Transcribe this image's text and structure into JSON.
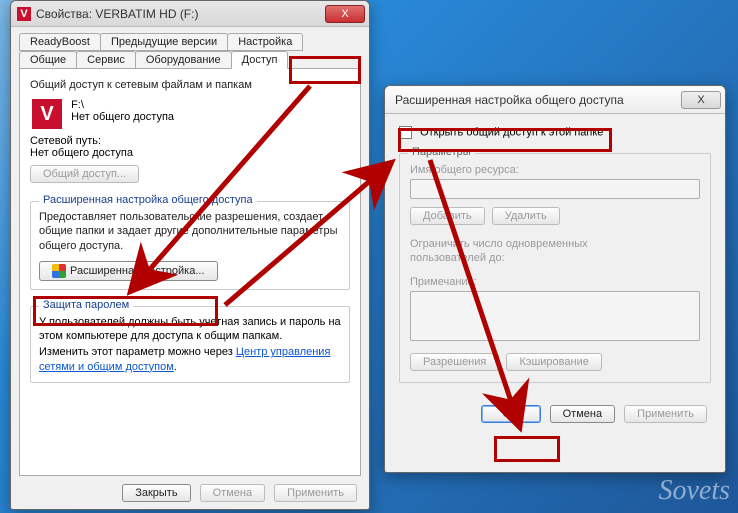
{
  "propWindow": {
    "title": "Свойства: VERBATIM HD (F:)",
    "tabsRow1": [
      "ReadyBoost",
      "Предыдущие версии",
      "Настройка"
    ],
    "tabsRow2": [
      "Общие",
      "Сервис",
      "Оборудование",
      "Доступ"
    ],
    "activeTab": "Доступ",
    "share": {
      "heading": "Общий доступ к сетевым файлам и папкам",
      "driveLabel": "F:\\",
      "driveStatus": "Нет общего доступа",
      "netPathLabel": "Сетевой путь:",
      "netPathValue": "Нет общего доступа",
      "shareBtn": "Общий доступ..."
    },
    "advanced": {
      "heading": "Расширенная настройка общего доступа",
      "text": "Предоставляет пользовательские разрешения, создает общие папки и задает другие дополнительные параметры общего доступа.",
      "btn": "Расширенная настройка..."
    },
    "password": {
      "heading": "Защита паролем",
      "text": "У пользователей должны быть учетная запись и пароль на этом компьютере для доступа к общим папкам.",
      "text2_prefix": "Изменить этот параметр можно через ",
      "link": "Центр управления сетями и общим доступом",
      "text2_suffix": "."
    },
    "footer": {
      "close": "Закрыть",
      "cancel": "Отмена",
      "apply": "Применить"
    },
    "closeX": "X"
  },
  "advWindow": {
    "title": "Расширенная настройка общего доступа",
    "closeX": "X",
    "checkboxLabel": "Открыть общий доступ к этой папке",
    "paramsLegend": "Параметры",
    "shareNameLabel": "Имя общего ресурса:",
    "addBtn": "Добавить",
    "removeBtn": "Удалить",
    "limitLabel": "Ограничить число одновременных пользователей до:",
    "notesLabel": "Примечание:",
    "permsBtn": "Разрешения",
    "cacheBtn": "Кэширование",
    "ok": "OK",
    "cancel": "Отмена",
    "apply": "Применить"
  },
  "watermark": "Sovets"
}
